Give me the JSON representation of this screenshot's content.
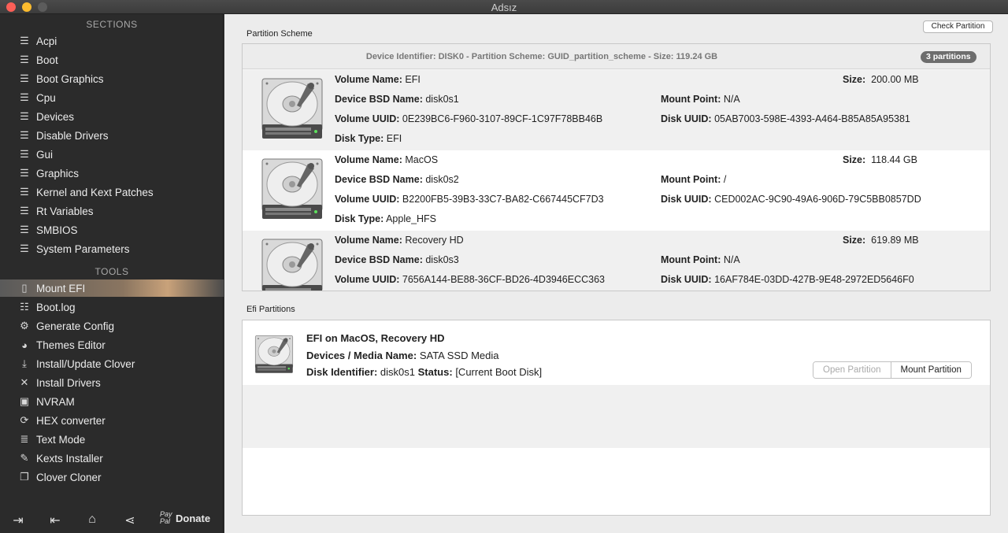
{
  "window": {
    "title": "Adsız"
  },
  "sidebar": {
    "sections_heading": "SECTIONS",
    "sections": [
      {
        "label": "Acpi",
        "icon": "list-icon"
      },
      {
        "label": "Boot",
        "icon": "list-icon"
      },
      {
        "label": "Boot Graphics",
        "icon": "list-icon"
      },
      {
        "label": "Cpu",
        "icon": "list-icon"
      },
      {
        "label": "Devices",
        "icon": "list-icon"
      },
      {
        "label": "Disable Drivers",
        "icon": "list-icon"
      },
      {
        "label": "Gui",
        "icon": "list-icon"
      },
      {
        "label": "Graphics",
        "icon": "list-icon"
      },
      {
        "label": "Kernel and Kext Patches",
        "icon": "list-icon"
      },
      {
        "label": "Rt Variables",
        "icon": "list-icon"
      },
      {
        "label": "SMBIOS",
        "icon": "list-icon"
      },
      {
        "label": "System Parameters",
        "icon": "list-icon"
      }
    ],
    "tools_heading": "TOOLS",
    "tools": [
      {
        "label": "Mount EFI",
        "icon": "drive-icon",
        "active": true
      },
      {
        "label": "Boot.log",
        "icon": "log-icon"
      },
      {
        "label": "Generate Config",
        "icon": "gear-icon"
      },
      {
        "label": "Themes Editor",
        "icon": "palette-icon"
      },
      {
        "label": "Install/Update Clover",
        "icon": "download-icon"
      },
      {
        "label": "Install Drivers",
        "icon": "tools-icon"
      },
      {
        "label": "NVRAM",
        "icon": "chip-icon"
      },
      {
        "label": "HEX converter",
        "icon": "refresh-icon"
      },
      {
        "label": "Text Mode",
        "icon": "text-icon"
      },
      {
        "label": "Kexts Installer",
        "icon": "plugin-icon"
      },
      {
        "label": "Clover Cloner",
        "icon": "copy-icon"
      }
    ],
    "bottom": {
      "paypal_text": "Pay Pal",
      "donate_label": "Donate"
    }
  },
  "main": {
    "check_partition_label": "Check Partition",
    "partition_scheme_label": "Partition Scheme",
    "device_header": "Device Identifier: DISK0 - Partition Scheme: GUID_partition_scheme - Size: 119.24 GB",
    "partitions_badge": "3 partitions",
    "labels": {
      "volume_name": "Volume Name:",
      "size": "Size:",
      "bsd_name": "Device BSD Name:",
      "mount_point": "Mount Point:",
      "volume_uuid": "Volume UUID:",
      "disk_uuid": "Disk UUID:",
      "disk_type": "Disk Type:"
    },
    "volumes": [
      {
        "name": "EFI",
        "size": "200.00 MB",
        "bsd": "disk0s1",
        "mount": "N/A",
        "volume_uuid": "0E239BC6-F960-3107-89CF-1C97F78BB46B",
        "disk_uuid": "05AB7003-598E-4393-A464-B85A85A95381",
        "type": "EFI"
      },
      {
        "name": "MacOS",
        "size": "118.44 GB",
        "bsd": "disk0s2",
        "mount": "/",
        "volume_uuid": "B2200FB5-39B3-33C7-BA82-C667445CF7D3",
        "disk_uuid": "CED002AC-9C90-49A6-906D-79C5BB0857DD",
        "type": "Apple_HFS"
      },
      {
        "name": "Recovery HD",
        "size": "619.89 MB",
        "bsd": "disk0s3",
        "mount": "N/A",
        "volume_uuid": "7656A144-BE88-36CF-BD26-4D3946ECC363",
        "disk_uuid": "16AF784E-03DD-427B-9E48-2972ED5646F0",
        "type": ""
      }
    ],
    "efi_partitions_label": "Efi Partitions",
    "efi": {
      "title": "EFI on MacOS, Recovery HD",
      "media_label": "Devices / Media Name:",
      "media_value": "SATA SSD Media",
      "disk_id_label": "Disk Identifier:",
      "disk_id_value": "disk0s1",
      "status_label": "Status:",
      "status_value": "[Current Boot Disk]",
      "open_button": "Open Partition",
      "mount_button": "Mount Partition"
    }
  }
}
